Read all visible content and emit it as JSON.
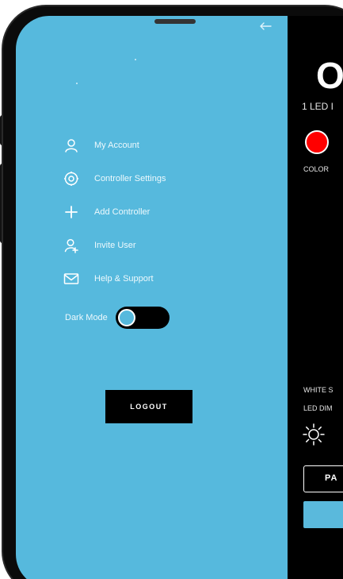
{
  "menu": {
    "items": [
      {
        "label": "My Account",
        "icon": "user-icon"
      },
      {
        "label": "Controller Settings",
        "icon": "gear-icon"
      },
      {
        "label": "Add Controller",
        "icon": "plus-icon"
      },
      {
        "label": "Invite User",
        "icon": "add-user-icon"
      },
      {
        "label": "Help & Support",
        "icon": "mail-icon"
      }
    ],
    "dark_mode_label": "Dark Mode",
    "dark_mode_on": false,
    "logout_label": "LOGOUT"
  },
  "background_app": {
    "title": "OC",
    "led_label": "1 LED I",
    "color_label": "COLOR",
    "selected_color": "#ff0000",
    "white_label": "WHITE S",
    "dim_label": "LED DIM",
    "pattern_button_label": "PA"
  },
  "colors": {
    "drawer": "#56b9dd",
    "background": "#000000",
    "accent": "#ff0000"
  }
}
